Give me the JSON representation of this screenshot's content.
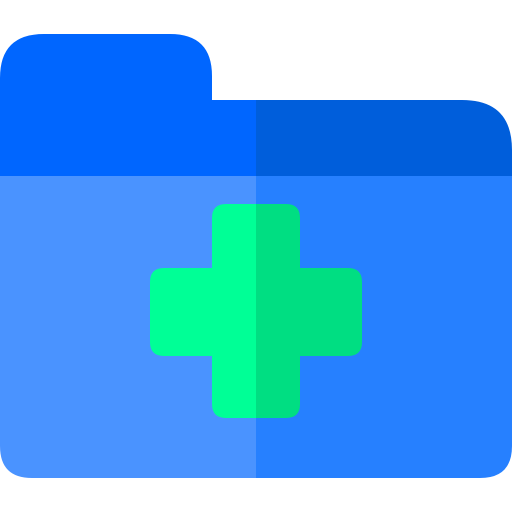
{
  "icon": {
    "name": "medical-folder-icon",
    "colors": {
      "tab_left": "#0066ff",
      "tab_right": "#005edb",
      "body_left": "#4a93ff",
      "body_right": "#2680ff",
      "cross_left": "#00ff96",
      "cross_right": "#00de82",
      "background": "#ffffff"
    }
  }
}
